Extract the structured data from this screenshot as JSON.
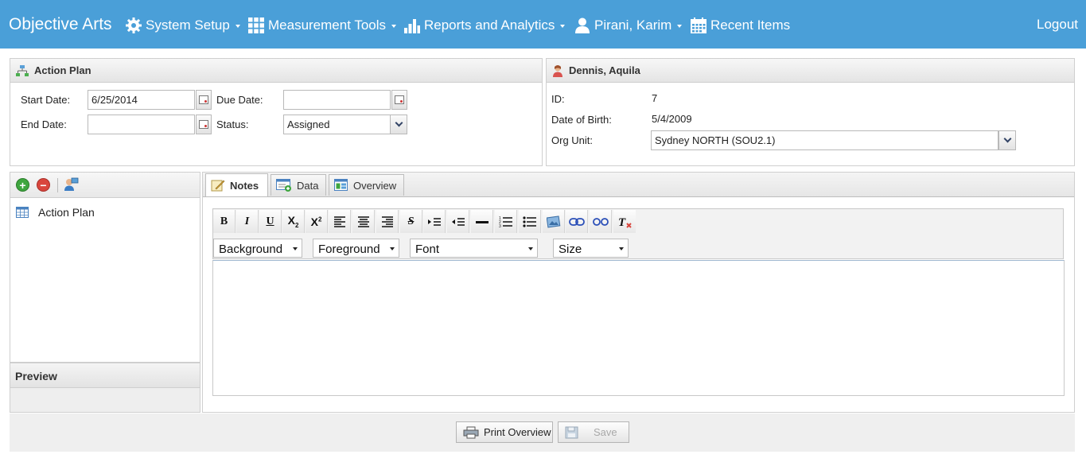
{
  "nav": {
    "brand": "Objective Arts",
    "items": [
      {
        "label": "System Setup",
        "icon": "gear-icon"
      },
      {
        "label": "Measurement Tools",
        "icon": "grid-icon"
      },
      {
        "label": "Reports and Analytics",
        "icon": "bar-chart-icon"
      },
      {
        "label": "Pirani, Karim",
        "icon": "user-icon"
      },
      {
        "label": "Recent Items",
        "icon": "calendar-icon"
      }
    ],
    "logout": "Logout"
  },
  "action_plan": {
    "title": "Action Plan",
    "start_date_label": "Start Date:",
    "start_date_value": "6/25/2014",
    "due_date_label": "Due Date:",
    "due_date_value": "",
    "end_date_label": "End Date:",
    "end_date_value": "",
    "status_label": "Status:",
    "status_value": "Assigned"
  },
  "client": {
    "name": "Dennis, Aquila",
    "id_label": "ID:",
    "id_value": "7",
    "dob_label": "Date of Birth:",
    "dob_value": "5/4/2009",
    "org_label": "Org Unit:",
    "org_value": "Sydney NORTH (SOU2.1)"
  },
  "tree": {
    "items": [
      {
        "label": "Action Plan"
      }
    ],
    "preview_label": "Preview"
  },
  "tabs": [
    {
      "label": "Notes",
      "active": true
    },
    {
      "label": "Data",
      "active": false
    },
    {
      "label": "Overview",
      "active": false
    }
  ],
  "editor": {
    "dropdowns": {
      "background": "Background",
      "foreground": "Foreground",
      "font": "Font",
      "size": "Size"
    },
    "content": ""
  },
  "footer": {
    "print_label": "Print Overview",
    "save_label": "Save"
  },
  "colors": {
    "topbar": "#4a9fd8",
    "panel_border": "#cfcfcf"
  }
}
